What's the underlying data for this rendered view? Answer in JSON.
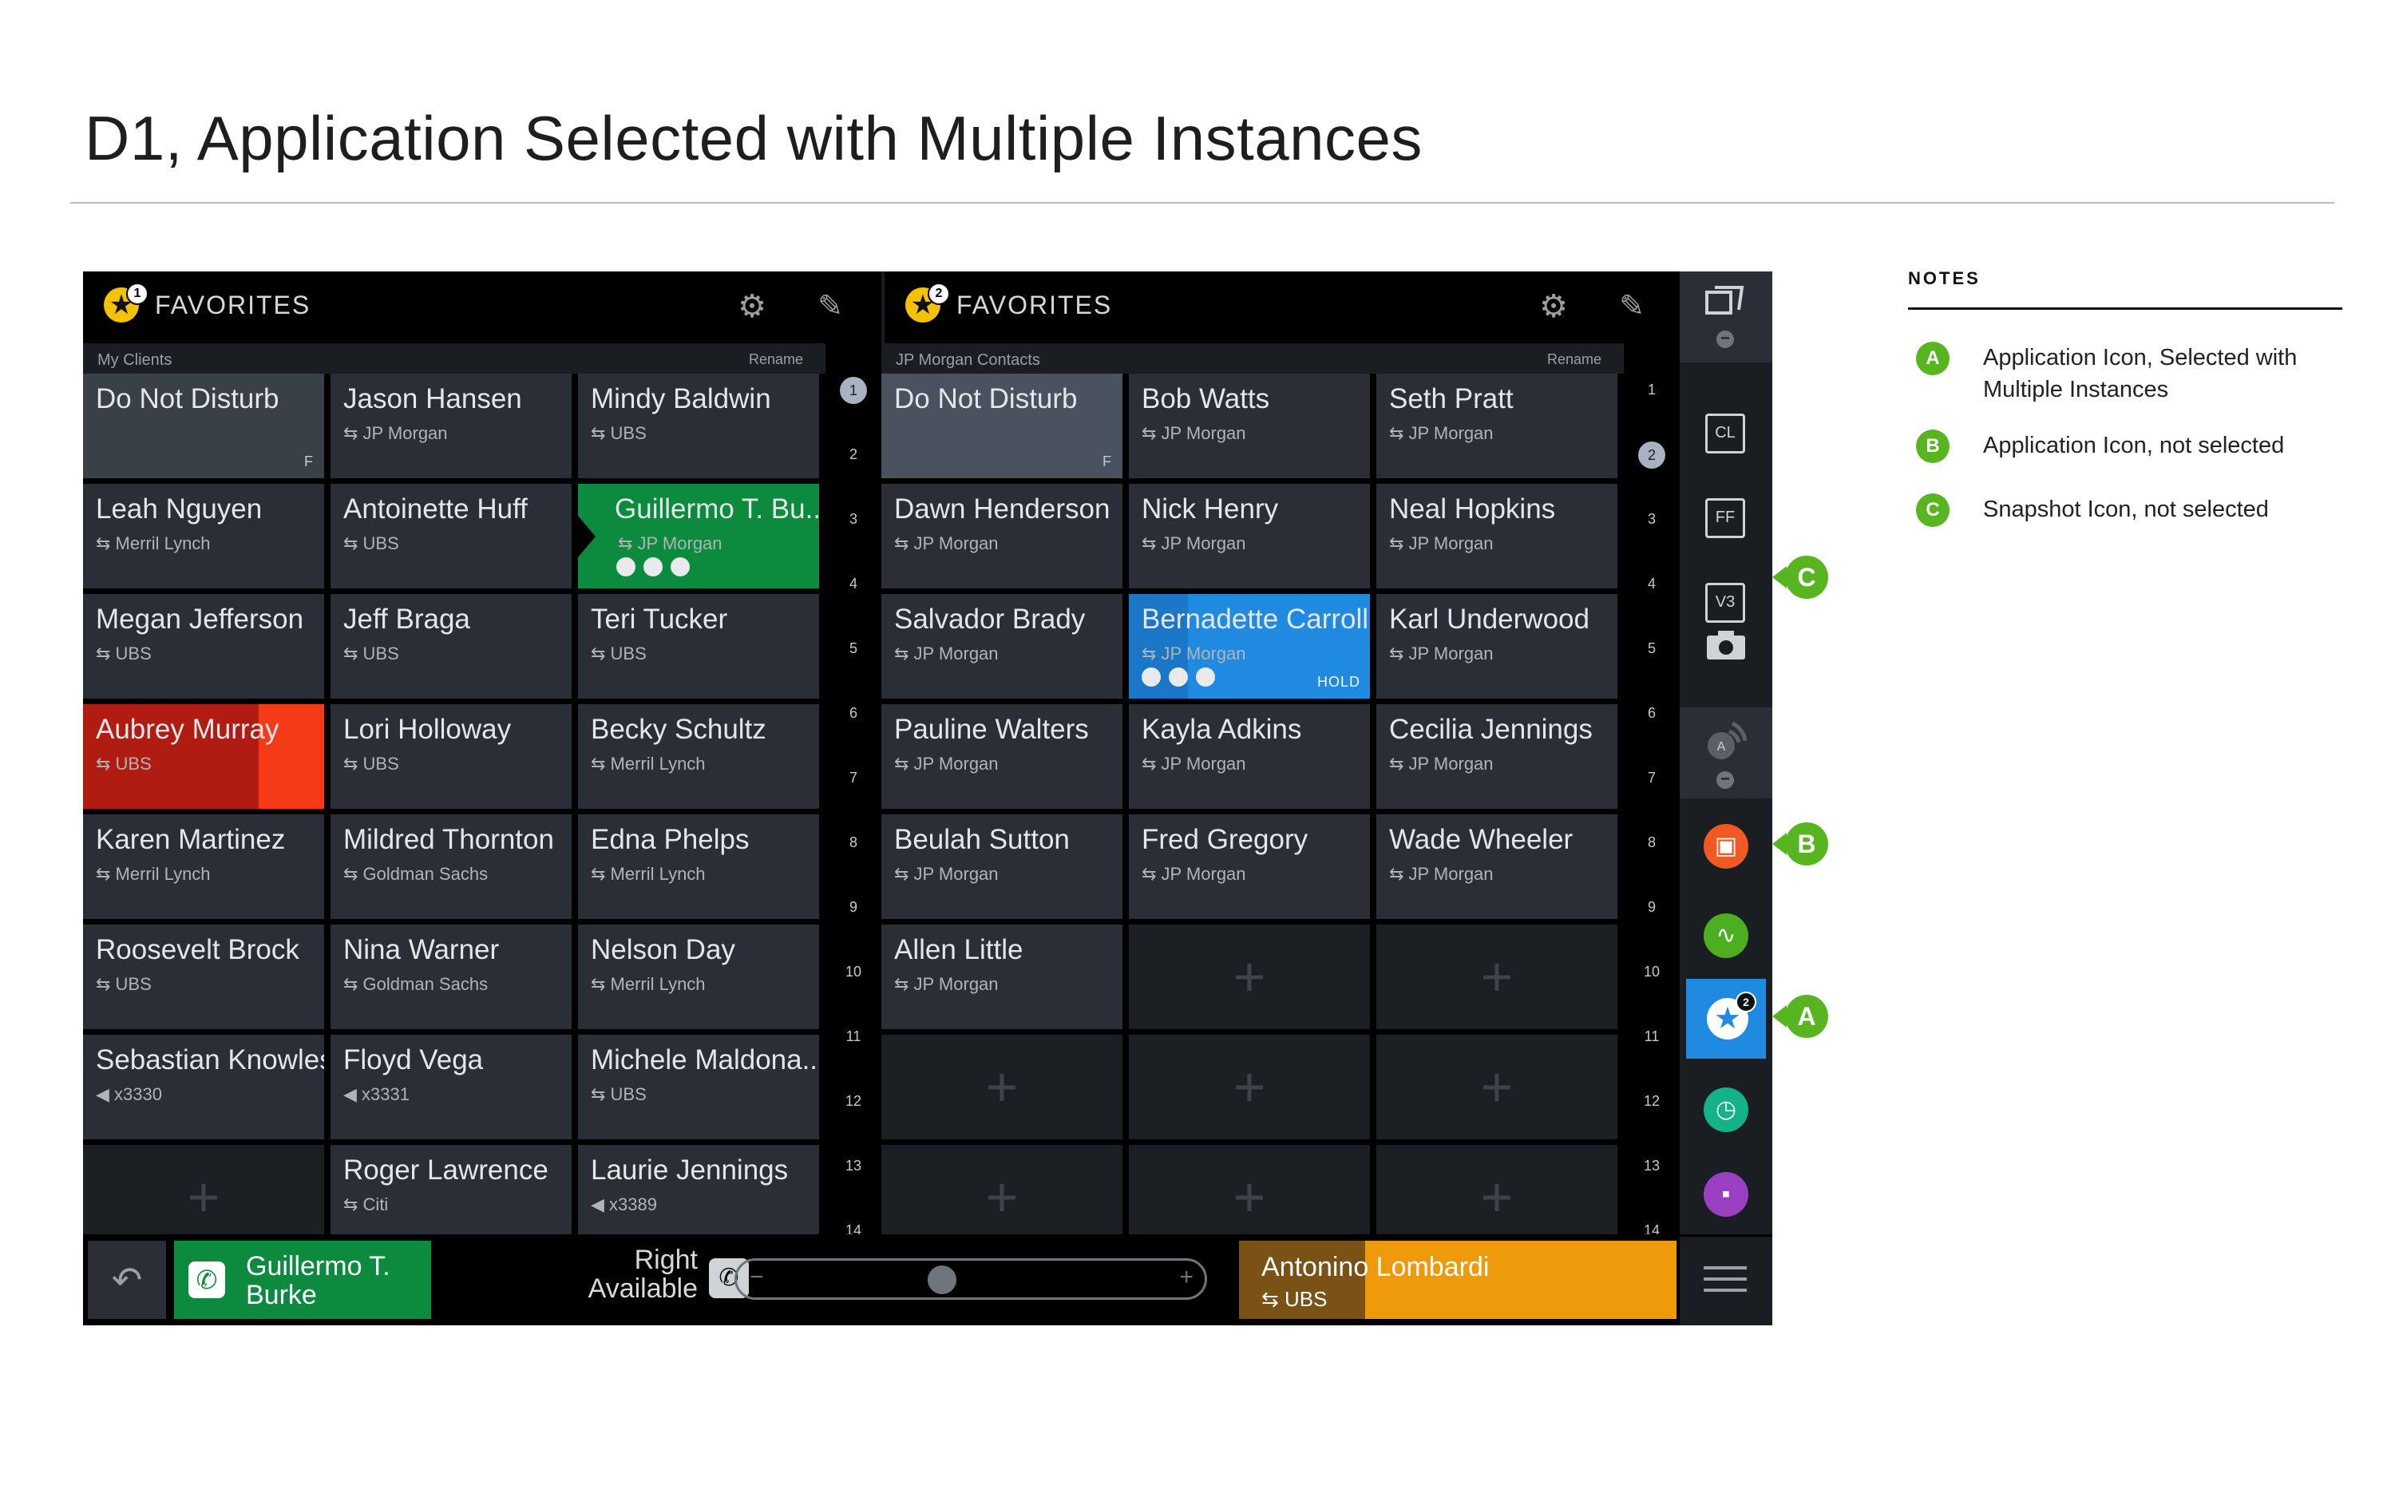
{
  "page": {
    "title": "D1, Application Selected with Multiple Instances"
  },
  "left_panel": {
    "badge": "1",
    "title": "FAVORITES",
    "sub_label": "My Clients",
    "rename": "Rename",
    "tiles": [
      {
        "name": "Do Not Disturb",
        "org": "",
        "flag": "F",
        "style": "dnd"
      },
      {
        "name": "Jason Hansen",
        "org": "⇆ JP Morgan",
        "style": ""
      },
      {
        "name": "Mindy Baldwin",
        "org": "⇆ UBS",
        "style": ""
      },
      {
        "name": "Leah Nguyen",
        "org": "⇆ Merril Lynch",
        "style": ""
      },
      {
        "name": "Antoinette Huff",
        "org": "⇆ UBS",
        "style": ""
      },
      {
        "name": "Guillermo T. Bu...",
        "org": "⇆ JP Morgan",
        "style": "green"
      },
      {
        "name": "Megan Jefferson",
        "org": "⇆ UBS",
        "style": ""
      },
      {
        "name": "Jeff Braga",
        "org": "⇆ UBS",
        "style": ""
      },
      {
        "name": "Teri Tucker",
        "org": "⇆ UBS",
        "style": ""
      },
      {
        "name": "Aubrey Murray",
        "org": "⇆ UBS",
        "style": "red"
      },
      {
        "name": "Lori Holloway",
        "org": "⇆ UBS",
        "style": ""
      },
      {
        "name": "Becky Schultz",
        "org": "⇆ Merril Lynch",
        "style": ""
      },
      {
        "name": "Karen Martinez",
        "org": "⇆ Merril Lynch",
        "style": ""
      },
      {
        "name": "Mildred Thornton",
        "org": "⇆ Goldman Sachs",
        "style": ""
      },
      {
        "name": "Edna Phelps",
        "org": "⇆ Merril Lynch",
        "style": ""
      },
      {
        "name": "Roosevelt Brock",
        "org": "⇆ UBS",
        "style": ""
      },
      {
        "name": "Nina Warner",
        "org": "⇆ Goldman Sachs",
        "style": ""
      },
      {
        "name": "Nelson Day",
        "org": "⇆ Merril Lynch",
        "style": ""
      },
      {
        "name": "Sebastian Knowles",
        "org": "◀ x3330",
        "style": ""
      },
      {
        "name": "Floyd Vega",
        "org": "◀ x3331",
        "style": ""
      },
      {
        "name": "Michele Maldona...",
        "org": "⇆ UBS",
        "style": ""
      },
      {
        "name": "",
        "org": "",
        "style": "empty"
      },
      {
        "name": "Roger Lawrence",
        "org": "⇆ Citi",
        "style": ""
      },
      {
        "name": "Laurie Jennings",
        "org": "◀ x3389",
        "style": ""
      }
    ],
    "index": [
      "1",
      "2",
      "3",
      "4",
      "5",
      "6",
      "7",
      "8",
      "9",
      "10",
      "11",
      "12",
      "13",
      "14"
    ],
    "selected_index": "1"
  },
  "right_panel": {
    "badge": "2",
    "title": "FAVORITES",
    "sub_label": "JP Morgan Contacts",
    "rename": "Rename",
    "tiles": [
      {
        "name": "Do Not Disturb",
        "org": "",
        "flag": "F",
        "style": "dnd-right"
      },
      {
        "name": "Bob Watts",
        "org": "⇆ JP Morgan",
        "style": ""
      },
      {
        "name": "Seth Pratt",
        "org": "⇆ JP Morgan",
        "style": ""
      },
      {
        "name": "Dawn Henderson",
        "org": "⇆ JP Morgan",
        "style": ""
      },
      {
        "name": "Nick Henry",
        "org": "⇆ JP Morgan",
        "style": ""
      },
      {
        "name": "Neal Hopkins",
        "org": "⇆ JP Morgan",
        "style": ""
      },
      {
        "name": "Salvador Brady",
        "org": "⇆ JP Morgan",
        "style": ""
      },
      {
        "name": "Bernadette Carroll",
        "org": "⇆ JP Morgan",
        "style": "blue",
        "hold": "HOLD"
      },
      {
        "name": "Karl Underwood",
        "org": "⇆ JP Morgan",
        "style": ""
      },
      {
        "name": "Pauline Walters",
        "org": "⇆ JP Morgan",
        "style": ""
      },
      {
        "name": "Kayla Adkins",
        "org": "⇆ JP Morgan",
        "style": ""
      },
      {
        "name": "Cecilia Jennings",
        "org": "⇆ JP Morgan",
        "style": ""
      },
      {
        "name": "Beulah Sutton",
        "org": "⇆ JP Morgan",
        "style": ""
      },
      {
        "name": "Fred Gregory",
        "org": "⇆ JP Morgan",
        "style": ""
      },
      {
        "name": "Wade Wheeler",
        "org": "⇆ JP Morgan",
        "style": ""
      },
      {
        "name": "Allen Little",
        "org": "⇆ JP Morgan",
        "style": ""
      },
      {
        "name": "",
        "org": "",
        "style": "empty"
      },
      {
        "name": "",
        "org": "",
        "style": "empty"
      },
      {
        "name": "",
        "org": "",
        "style": "empty"
      },
      {
        "name": "",
        "org": "",
        "style": "empty"
      },
      {
        "name": "",
        "org": "",
        "style": "empty"
      },
      {
        "name": "",
        "org": "",
        "style": "empty"
      },
      {
        "name": "",
        "org": "",
        "style": "empty"
      },
      {
        "name": "",
        "org": "",
        "style": "empty"
      }
    ],
    "index": [
      "1",
      "2",
      "3",
      "4",
      "5",
      "6",
      "7",
      "8",
      "9",
      "10",
      "11",
      "12",
      "13",
      "14"
    ],
    "selected_index": "2"
  },
  "sidebar": {
    "icons": [
      "cards-icon",
      "cl-icon",
      "ff-icon",
      "v3-icon",
      "camera-icon",
      "app-a-icon",
      "contact-app-icon",
      "pulse-icon",
      "favorites-icon",
      "clock-icon",
      "lock-icon",
      "menu-icon"
    ],
    "cl_label": "CL",
    "ff_label": "FF",
    "v3_label": "V3",
    "a_label": "A",
    "selected_badge": "2",
    "colors": {
      "orange": "#f05a22",
      "green": "#4caf20",
      "blue": "#1f8ae0",
      "teal": "#14b28a",
      "purple": "#9b3fc2"
    }
  },
  "bottom_bar": {
    "call_name": "Guillermo T. Burke",
    "right_line1": "Right",
    "right_line2": "Available",
    "volume_minus": "−",
    "volume_plus": "+",
    "volume_level": 0.39,
    "active_name": "Antonino Lombardi",
    "active_org": "⇆ UBS"
  },
  "callouts": {
    "a": "A",
    "b": "B",
    "c": "C"
  },
  "notes": {
    "title": "NOTES",
    "items": [
      {
        "badge": "A",
        "text": "Application Icon, Selected with Multiple Instances"
      },
      {
        "badge": "B",
        "text": "Application Icon, not selected"
      },
      {
        "badge": "C",
        "text": "Snapshot Icon, not selected"
      }
    ]
  }
}
